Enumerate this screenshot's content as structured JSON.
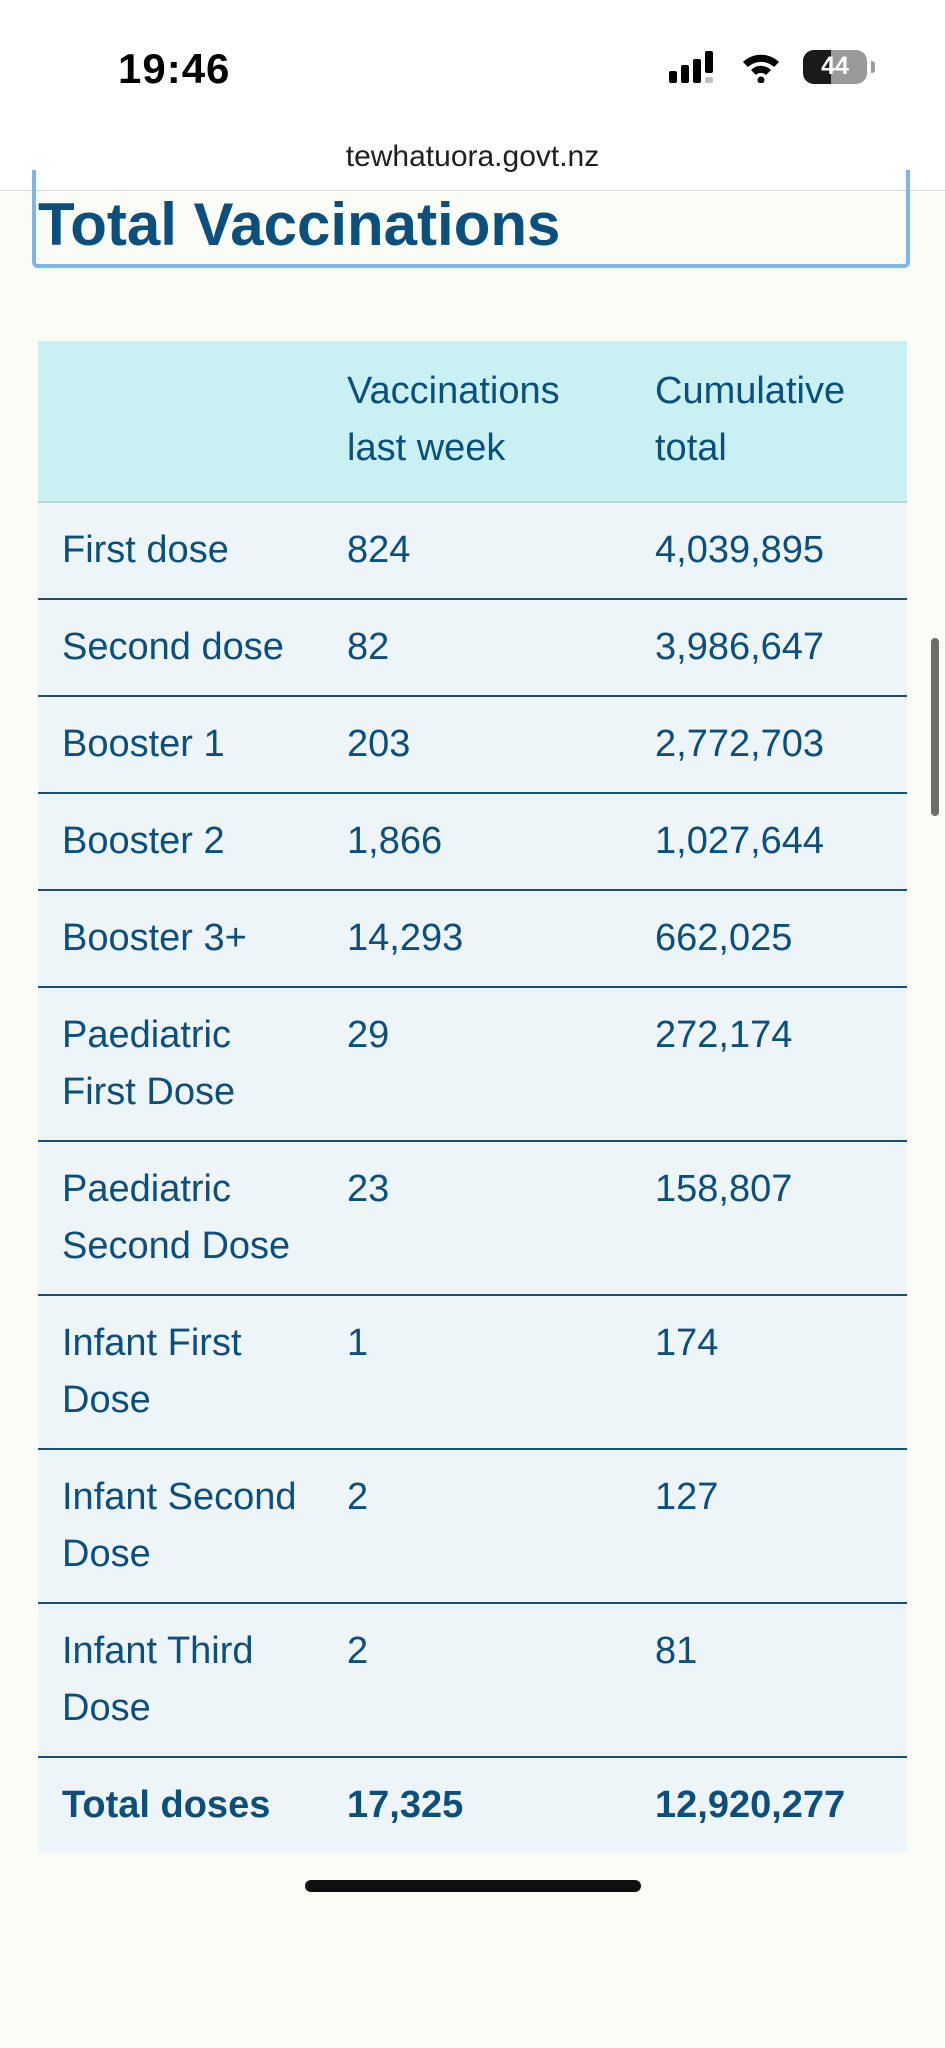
{
  "status_bar": {
    "time": "19:46",
    "battery": "44"
  },
  "browser": {
    "url": "tewhatuora.govt.nz"
  },
  "page": {
    "title": "Total Vaccinations"
  },
  "table": {
    "headers": [
      "",
      "Vaccinations last week",
      "Cumulative total"
    ],
    "rows": [
      [
        "First dose",
        "824",
        "4,039,895"
      ],
      [
        "Second dose",
        "82",
        "3,986,647"
      ],
      [
        "Booster 1",
        "203",
        "2,772,703"
      ],
      [
        "Booster 2",
        "1,866",
        "1,027,644"
      ],
      [
        "Booster 3+",
        "14,293",
        "662,025"
      ],
      [
        "Paediatric First Dose",
        "29",
        "272,174"
      ],
      [
        "Paediatric Second Dose",
        "23",
        "158,807"
      ],
      [
        "Infant First Dose",
        "1",
        "174"
      ],
      [
        "Infant Second Dose",
        "2",
        "127"
      ],
      [
        "Infant Third Dose",
        "2",
        "81"
      ]
    ],
    "total": [
      "Total doses",
      "17,325",
      "12,920,277"
    ]
  },
  "icons": [
    "cellular-signal-icon",
    "wifi-icon",
    "battery-icon"
  ],
  "colors": {
    "heading": "#0b4f7d",
    "header_bg": "#c9f0f3",
    "row_bg": "#eef5f8",
    "heading_border": "#7fb5e8"
  }
}
